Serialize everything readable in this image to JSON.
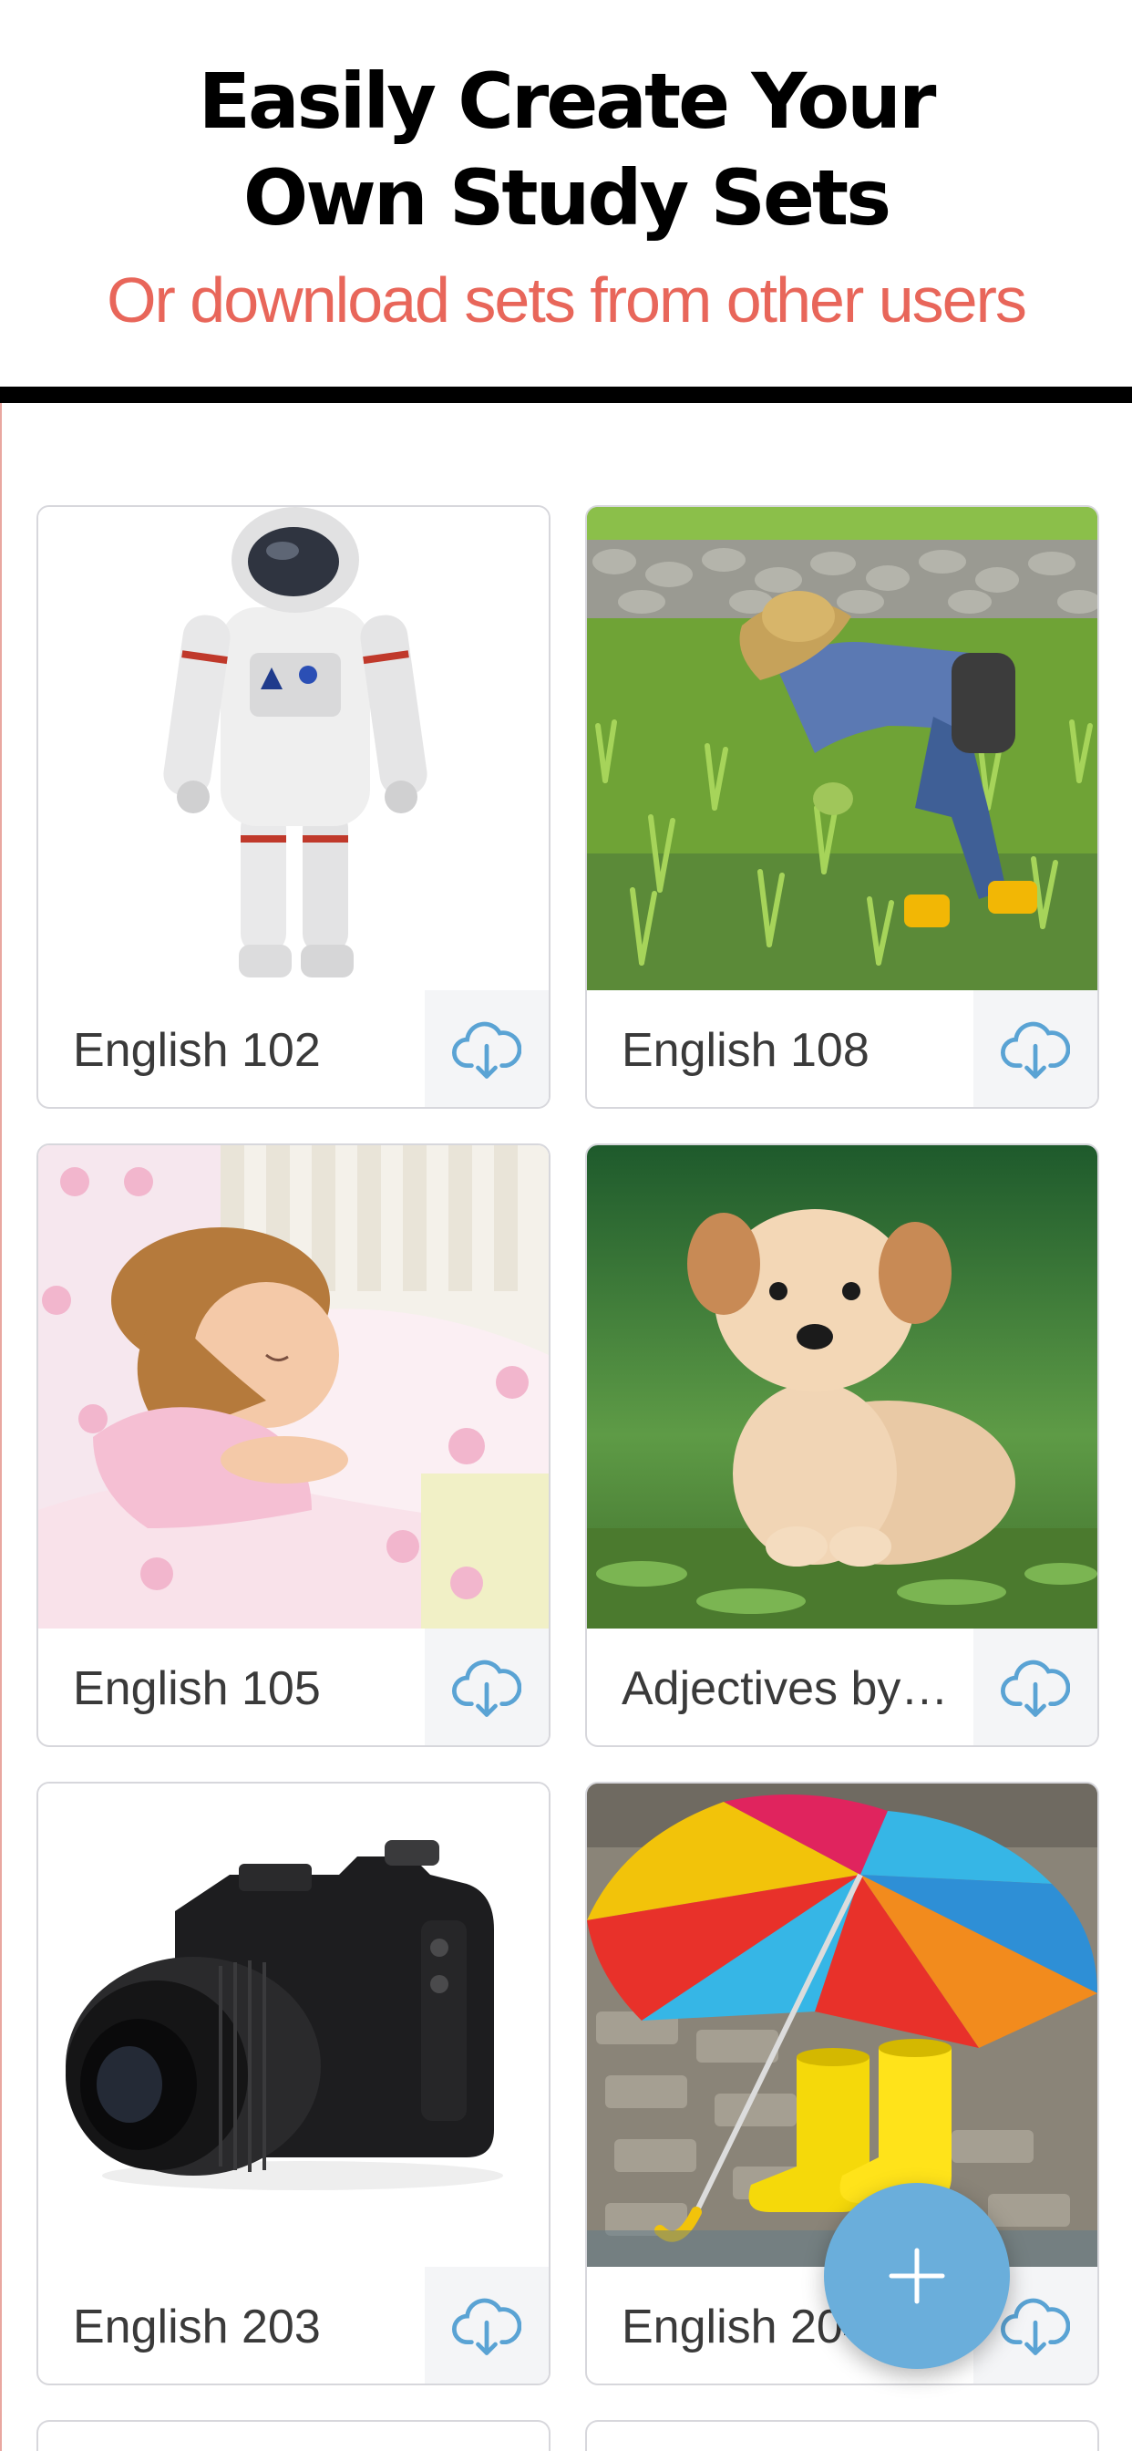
{
  "promo": {
    "headline_line1": "Easily Create Your",
    "headline_line2": "Own Study Sets",
    "subheadline": "Or download sets from other users"
  },
  "colors": {
    "headline": "#000000",
    "subheadline": "#e8665a",
    "accent": "#6aaedb",
    "card_border": "#d7d7dc",
    "download_bg": "#f4f5f7"
  },
  "study_sets": [
    {
      "title": "English 102",
      "image": "astronaut-image",
      "action_icon": "cloud-download-icon"
    },
    {
      "title": "English 108",
      "image": "rice-farmer-image",
      "action_icon": "cloud-download-icon"
    },
    {
      "title": "English 105",
      "image": "sleeping-girl-image",
      "action_icon": "cloud-download-icon"
    },
    {
      "title": "Adjectives by…",
      "image": "puppy-image",
      "action_icon": "cloud-download-icon"
    },
    {
      "title": "English 203",
      "image": "camera-image",
      "action_icon": "cloud-download-icon"
    },
    {
      "title": "English 204",
      "image": "umbrella-boots-image",
      "action_icon": "cloud-download-icon"
    }
  ],
  "fab": {
    "icon": "plus-icon"
  }
}
